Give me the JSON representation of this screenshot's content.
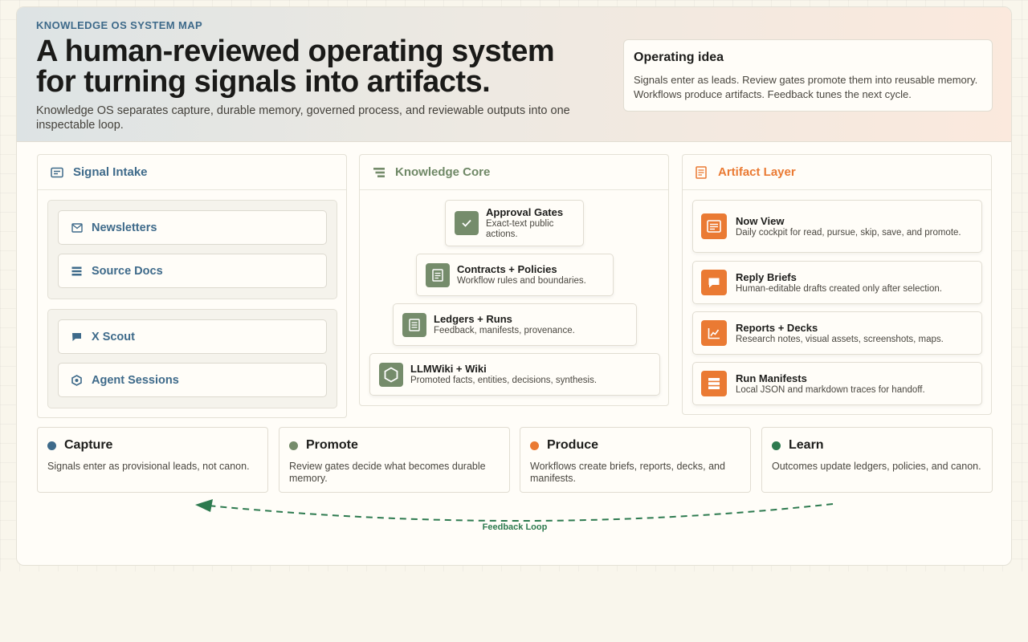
{
  "hero": {
    "eyebrow": "KNOWLEDGE OS SYSTEM MAP",
    "title": "A human-reviewed operating system for turning signals into artifacts.",
    "subtitle": "Knowledge OS separates capture, durable memory, governed process, and reviewable outputs into one inspectable loop."
  },
  "operating_idea": {
    "title": "Operating idea",
    "body": "Signals enter as leads. Review gates promote them into reusable memory. Workflows produce artifacts. Feedback tunes the next cycle."
  },
  "signal_intake": {
    "title": "Signal Intake",
    "icon": "inbox-icon",
    "color": "#3e6a8a",
    "groups": [
      {
        "items": [
          {
            "label": "Newsletters",
            "icon": "mail-icon"
          },
          {
            "label": "Source Docs",
            "icon": "list-icon"
          }
        ]
      },
      {
        "items": [
          {
            "label": "X Scout",
            "icon": "chat-icon"
          },
          {
            "label": "Agent Sessions",
            "icon": "hexagon-icon"
          }
        ]
      }
    ]
  },
  "knowledge_core": {
    "title": "Knowledge Core",
    "icon": "layers-icon",
    "color": "#758c6b",
    "items": [
      {
        "title": "Approval Gates",
        "desc": "Exact-text public actions.",
        "icon": "check-icon"
      },
      {
        "title": "Contracts + Policies",
        "desc": "Workflow rules and boundaries.",
        "icon": "document-icon"
      },
      {
        "title": "Ledgers + Runs",
        "desc": "Feedback, manifests, provenance.",
        "icon": "ledger-icon"
      },
      {
        "title": "LLMWiki + Wiki",
        "desc": "Promoted facts, entities, decisions, synthesis.",
        "icon": "hexagon-icon"
      }
    ]
  },
  "artifact_layer": {
    "title": "Artifact Layer",
    "icon": "page-icon",
    "color": "#ea7a33",
    "items": [
      {
        "title": "Now View",
        "desc": "Daily cockpit for read, pursue, skip, save, and promote.",
        "icon": "dashboard-icon"
      },
      {
        "title": "Reply Briefs",
        "desc": "Human-editable drafts created only after selection.",
        "icon": "speech-bubble-icon"
      },
      {
        "title": "Reports + Decks",
        "desc": "Research notes, visual assets, screenshots, maps.",
        "icon": "chart-icon"
      },
      {
        "title": "Run Manifests",
        "desc": "Local JSON and markdown traces for handoff.",
        "icon": "stack-icon"
      }
    ]
  },
  "stages": [
    {
      "title": "Capture",
      "desc": "Signals enter as provisional leads, not canon.",
      "color": "#3e6a8a"
    },
    {
      "title": "Promote",
      "desc": "Review gates decide what becomes durable memory.",
      "color": "#758c6b"
    },
    {
      "title": "Produce",
      "desc": "Workflows create briefs, reports, decks, and manifests.",
      "color": "#ea7a33"
    },
    {
      "title": "Learn",
      "desc": "Outcomes update ledgers, policies, and canon.",
      "color": "#2d7a4f"
    }
  ],
  "feedback_loop": {
    "label": "Feedback Loop",
    "color": "#2d7a4f"
  }
}
